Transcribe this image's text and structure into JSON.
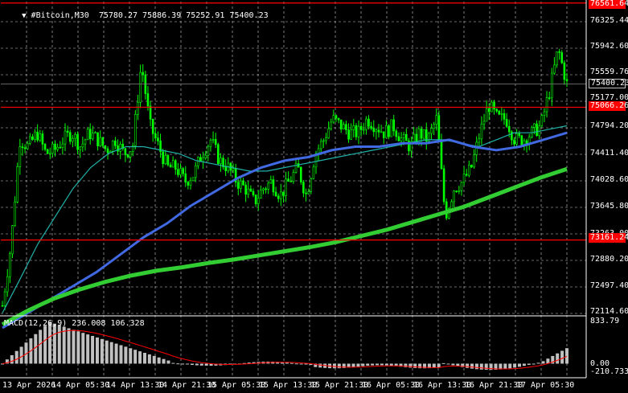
{
  "header": {
    "symbol": "#Bitcoin,M30",
    "open": "75780.27",
    "high": "75886.39",
    "low": "75252.91",
    "close": "75400.23"
  },
  "price_axis": {
    "labels": [
      "76325.44",
      "75942.60",
      "75559.76",
      "75177.00",
      "74794.20",
      "74411.40",
      "74028.60",
      "73645.80",
      "73263.00",
      "72880.20",
      "72497.40",
      "72114.60"
    ],
    "current_price_tag": "75400.23",
    "level_tags": [
      "76561.64",
      "75066.26",
      "73161.24"
    ]
  },
  "macd": {
    "header": "MACD(12,26,9) 236.008 106.328",
    "axis_labels": [
      "833.79",
      "0.00",
      "-210.733"
    ]
  },
  "time_axis": {
    "labels": [
      "13 Apr 2026",
      "14 Apr 05:30",
      "14 Apr 13:30",
      "14 Apr 21:30",
      "15 Apr 05:30",
      "15 Apr 13:30",
      "15 Apr 21:30",
      "16 Apr 05:30",
      "16 Apr 13:30",
      "16 Apr 21:30",
      "17 Apr 05:30"
    ]
  },
  "colors": {
    "background": "#000000",
    "grid": "#ffffff",
    "candle": "#00ff00",
    "level_line": "#ff0000",
    "ma_fast": "#20b2aa",
    "ma_mid": "#4169e1",
    "ma_slow": "#32cd32",
    "histogram": "#c0c0c0",
    "signal": "#ff0000"
  },
  "chart_data": {
    "type": "line",
    "title": "#Bitcoin,M30",
    "y_range": [
      72114.6,
      76561.64
    ],
    "levels": [
      76561.64,
      75066.26,
      73161.24
    ],
    "series": [
      {
        "values": [
          72220,
          73100,
          74600,
          74500,
          74700,
          74400,
          74450,
          74600,
          74700,
          74500,
          74700,
          74600,
          74450,
          74600,
          74400,
          74500,
          75700,
          74800,
          74500,
          74200,
          74200,
          74000,
          74100,
          74400,
          74600,
          74300,
          74200,
          74000,
          73900,
          73700,
          73900,
          74000,
          73800,
          74000,
          74200,
          73800,
          74400,
          74600,
          74900,
          74800,
          74700,
          74700,
          74900,
          74800,
          74700,
          74800,
          74600,
          74500,
          74700,
          74600,
          74900,
          73500,
          73900,
          74000,
          74200,
          74700,
          75100,
          74900,
          74900,
          74600,
          74600,
          74700,
          74800,
          75300,
          75900,
          75400
        ]
      },
      {
        "name": "",
        "values": [
          72114.6,
          72600,
          73100,
          73500,
          73900,
          74200,
          74400,
          74500,
          74500,
          74450,
          74400,
          74300,
          74250,
          74200,
          74150,
          74150,
          74200,
          74250,
          74300,
          74350,
          74400,
          74450,
          74500,
          74550,
          74600,
          74600,
          74550,
          74500,
          74600,
          74700,
          74700,
          74750,
          74800
        ]
      },
      {
        "values": [
          71900,
          72100,
          72300,
          72500,
          72700,
          72950,
          73200,
          73400,
          73650,
          73850,
          74050,
          74200,
          74300,
          74350,
          74450,
          74500,
          74500,
          74550,
          74550,
          74600,
          74500,
          74450,
          74500,
          74600,
          74700
        ]
      },
      {
        "values": [
          71950,
          72150,
          72320,
          72450,
          72560,
          72650,
          72720,
          72770,
          72830,
          72880,
          72940,
          73000,
          73060,
          73130,
          73220,
          73310,
          73420,
          73530,
          73640,
          73780,
          73920,
          74060,
          74180
        ]
      }
    ]
  }
}
